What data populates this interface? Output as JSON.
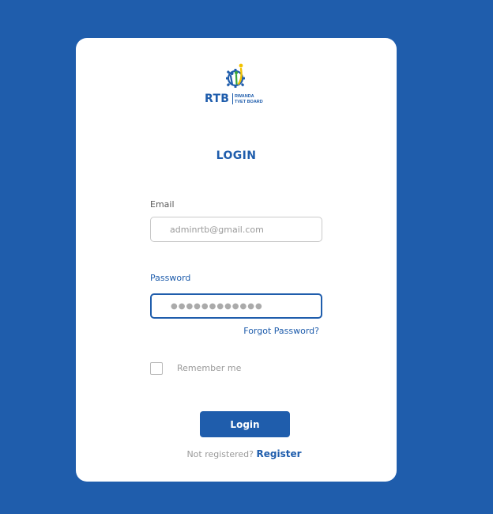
{
  "logo": {
    "short_name": "RTB",
    "full_name_line1": "RWANDA",
    "full_name_line2": "TVET BOARD",
    "icon": "rtb-gear-people-logo",
    "colors": {
      "blue": "#1f5dac",
      "yellow": "#f2c200",
      "green": "#3aa53a"
    }
  },
  "form": {
    "title": "LOGIN",
    "email_label": "Email",
    "email_value": "adminrtb@gmail.com",
    "password_label": "Password",
    "password_masked": "●●●●●●●●●●●●",
    "forgot_password": "Forgot Password?",
    "remember_me": "Remember me",
    "remember_checked": false,
    "login_button": "Login",
    "register_prompt": "Not registered? ",
    "register_link": "Register"
  },
  "colors": {
    "background": "#1f5dac",
    "card": "#ffffff",
    "accent": "#1f5dac",
    "muted_text": "#9a9a9a"
  }
}
